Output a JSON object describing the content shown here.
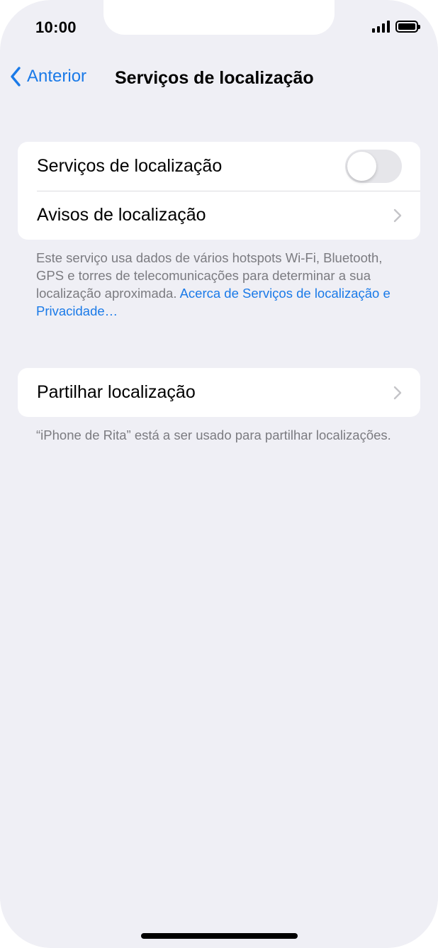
{
  "status_bar": {
    "time": "10:00"
  },
  "nav": {
    "back_label": "Anterior",
    "title": "Serviços de localização"
  },
  "group1": {
    "rows": [
      {
        "label": "Serviços de localização",
        "toggle_on": false
      },
      {
        "label": "Avisos de localização"
      }
    ],
    "footer_text": "Este serviço usa dados de vários hotspots Wi-Fi, Bluetooth, GPS e torres de telecomunicações para determinar a sua localização aproximada.",
    "footer_link": "Acerca de Serviços de localização e Privacidade…"
  },
  "group2": {
    "rows": [
      {
        "label": "Partilhar localização"
      }
    ],
    "footer_text": "“iPhone de Rita” está a ser usado para partilhar localizações."
  },
  "colors": {
    "accent": "#1a7ae8",
    "background": "#efeff5",
    "cell": "#ffffff",
    "secondary_text": "#7b7b80"
  },
  "icons": {
    "back": "chevron-left-icon",
    "disclosure": "chevron-right-icon",
    "signal": "cellular-signal-icon",
    "battery": "battery-icon"
  }
}
